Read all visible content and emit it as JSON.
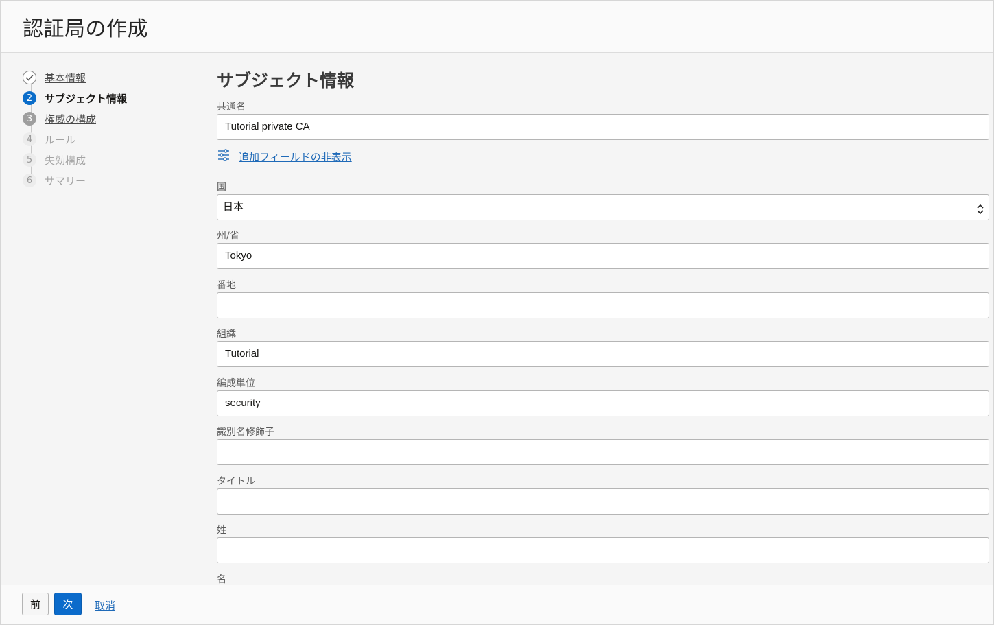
{
  "header": {
    "title": "認証局の作成"
  },
  "steps": [
    {
      "num": "",
      "label": "基本情報",
      "state": "done"
    },
    {
      "num": "2",
      "label": "サブジェクト情報",
      "state": "current"
    },
    {
      "num": "3",
      "label": "権威の構成",
      "state": "visited"
    },
    {
      "num": "4",
      "label": "ルール",
      "state": "future"
    },
    {
      "num": "5",
      "label": "失効構成",
      "state": "future"
    },
    {
      "num": "6",
      "label": "サマリー",
      "state": "future"
    }
  ],
  "main": {
    "section_title": "サブジェクト情報",
    "common_name": {
      "label": "共通名",
      "value": "Tutorial private CA"
    },
    "toggle_link": {
      "label": "追加フィールドの非表示",
      "icon": "sliders-icon"
    },
    "country": {
      "label": "国",
      "value": "日本"
    },
    "state": {
      "label": "州/省",
      "value": "Tokyo"
    },
    "street": {
      "label": "番地",
      "value": ""
    },
    "organization": {
      "label": "組織",
      "value": "Tutorial"
    },
    "org_unit": {
      "label": "編成単位",
      "value": "security"
    },
    "dn_qualifier": {
      "label": "識別名修飾子",
      "value": ""
    },
    "title": {
      "label": "タイトル",
      "value": ""
    },
    "surname": {
      "label": "姓",
      "value": ""
    },
    "given_name": {
      "label": "名"
    }
  },
  "footer": {
    "prev_label": "前",
    "next_label": "次",
    "cancel_label": "取消"
  },
  "colors": {
    "accent": "#0a6dca",
    "link": "#1f6ab8"
  }
}
